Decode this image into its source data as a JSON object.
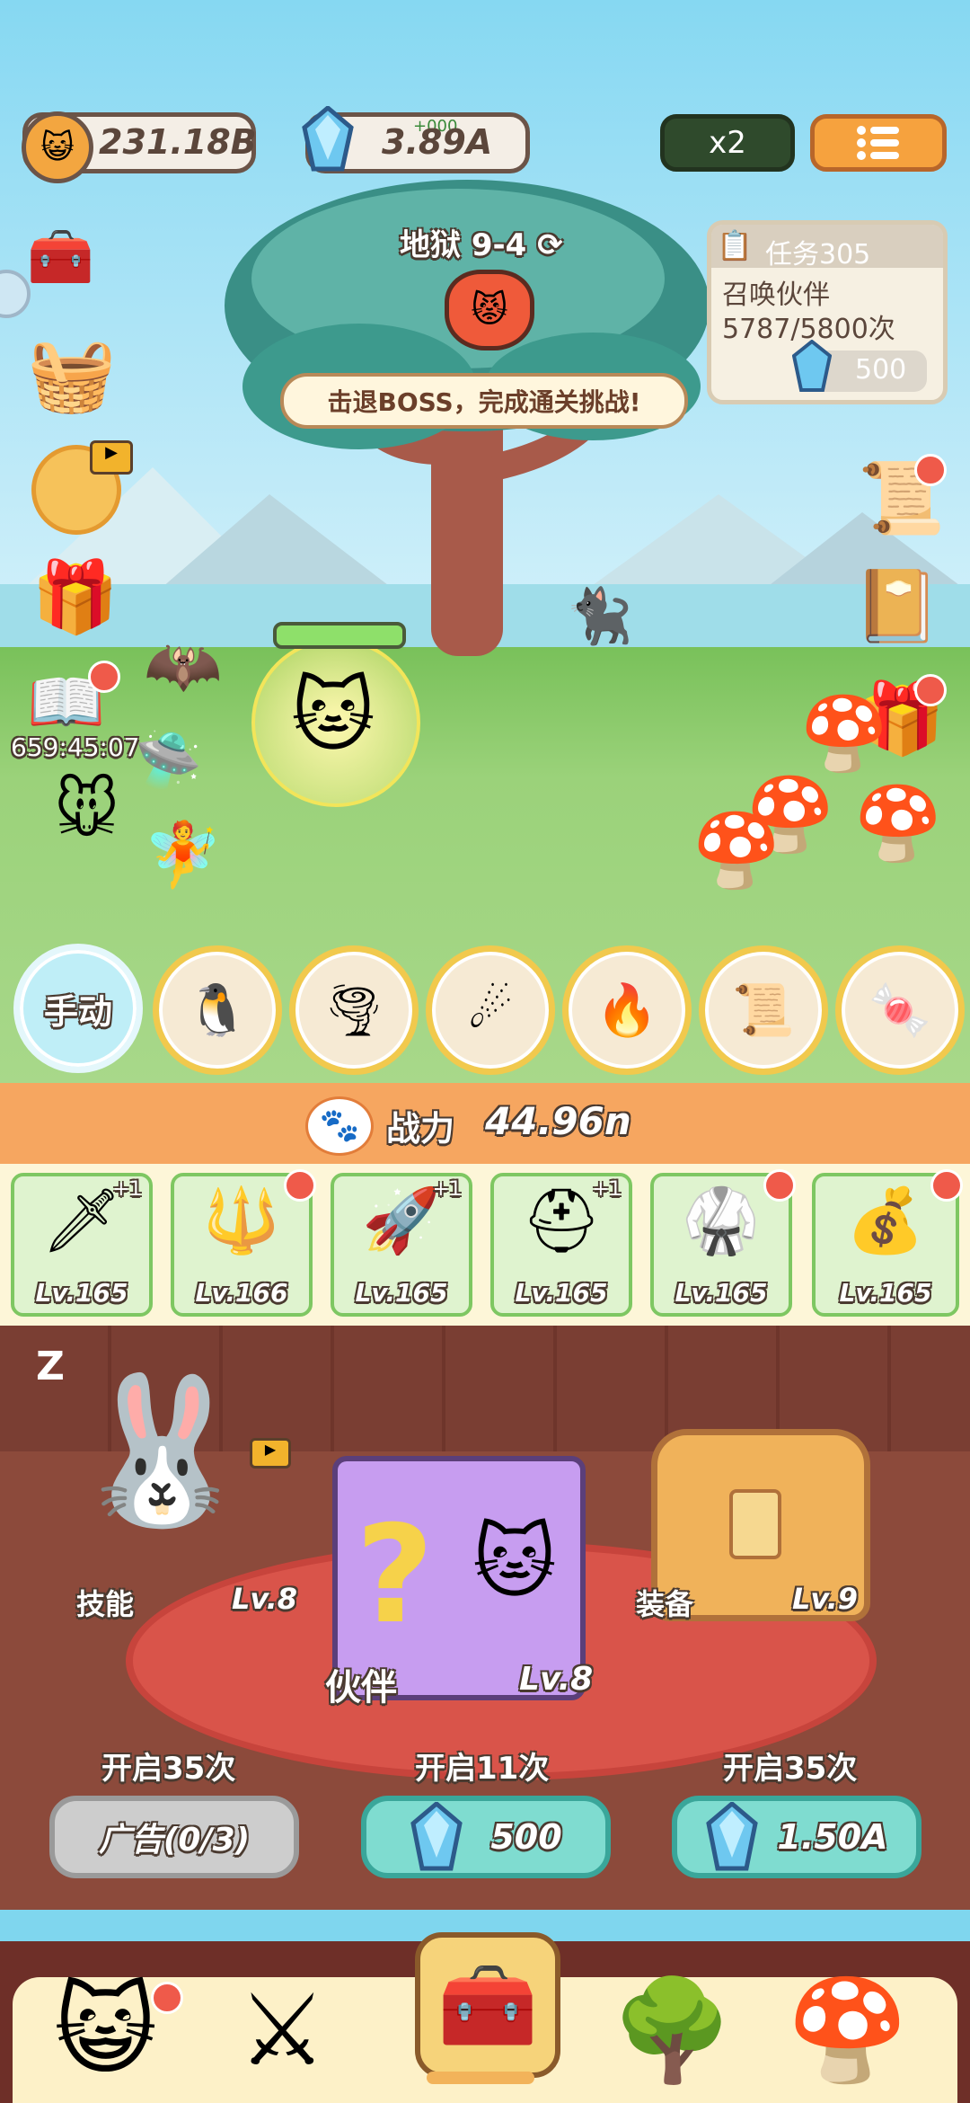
{
  "currency": {
    "coins": "231.18B",
    "gems": "3.89A",
    "gems_overlay": "+000"
  },
  "top_buttons": {
    "speed": "x2",
    "menu_icon": "list-icon"
  },
  "stage": {
    "title": "地狱 9-4",
    "banner": "击退BOSS，完成通关挑战!"
  },
  "task": {
    "title": "任务305",
    "desc": "召唤伙伴5787/5800次",
    "reward": "500"
  },
  "left_timer": "659:45:07",
  "skills": {
    "manual_label": "手动",
    "icons": [
      "penguin-icon",
      "tornado-icon",
      "meteor-icon",
      "fire-icon",
      "scroll-icon",
      "candy-icon"
    ]
  },
  "power": {
    "label": "战力",
    "value": "44.96n"
  },
  "equipment": [
    {
      "icon": "sword-icon",
      "level": "Lv.165",
      "badge": "+1",
      "dot": false
    },
    {
      "icon": "spear-icon",
      "level": "Lv.166",
      "badge": "",
      "dot": true
    },
    {
      "icon": "rocket-icon",
      "level": "Lv.165",
      "badge": "+1",
      "dot": false
    },
    {
      "icon": "helmet-icon",
      "level": "Lv.165",
      "badge": "+1",
      "dot": false
    },
    {
      "icon": "armor-icon",
      "level": "Lv.165",
      "badge": "",
      "dot": true
    },
    {
      "icon": "sack-icon",
      "level": "Lv.165",
      "badge": "",
      "dot": true
    }
  ],
  "summon": {
    "skill": {
      "label": "技能",
      "level": "Lv.8",
      "count": "开启35次",
      "button": "广告(0/3)"
    },
    "partner": {
      "label": "伙伴",
      "level": "Lv.8",
      "count": "开启11次",
      "button": "500"
    },
    "equip": {
      "label": "装备",
      "level": "Lv.9",
      "count": "开启35次",
      "button": "1.50A"
    }
  },
  "tabs": [
    "cat-icon",
    "weapon-icon",
    "chest-icon",
    "tree-icon",
    "mushroom-house-icon"
  ],
  "colors": {
    "accent": "#f6a660",
    "gem_button": "#7fdcd0",
    "danger_dot": "#ef5a4a"
  }
}
